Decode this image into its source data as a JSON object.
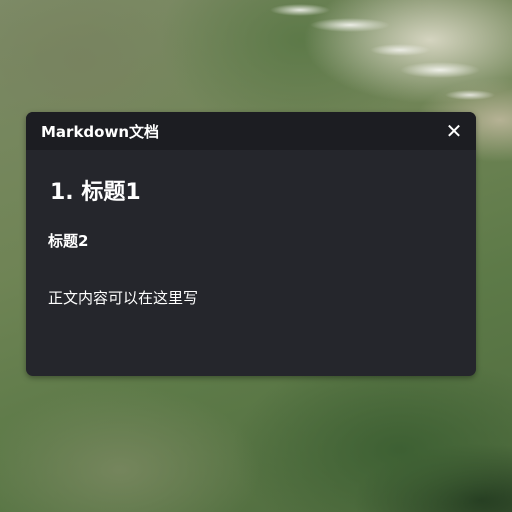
{
  "panel": {
    "title": "Markdown文档",
    "close_label": "✕"
  },
  "document": {
    "h1": "1. 标题1",
    "h2": "标题2",
    "paragraph": "正文内容可以在这里写"
  },
  "colors": {
    "panel_bg": "#25262c",
    "header_bg": "#1c1d22",
    "text": "#ffffff"
  },
  "icons": {
    "close": "close-icon"
  }
}
